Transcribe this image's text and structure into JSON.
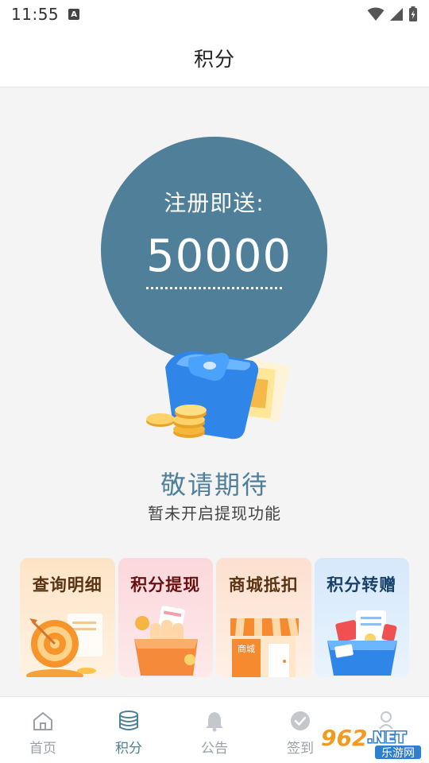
{
  "status_bar": {
    "time": "11:55",
    "indicator": "A",
    "icons": [
      "wifi-icon",
      "signal-icon",
      "battery-icon"
    ]
  },
  "header": {
    "title": "积分"
  },
  "bonus": {
    "label": "注册即送:",
    "value": "50000"
  },
  "notice": {
    "title": "敬请期待",
    "subtitle": "暂未开启提现功能"
  },
  "cards": [
    {
      "label": "查询明细",
      "icon": "target-icon"
    },
    {
      "label": "积分提现",
      "icon": "wallet-icon"
    },
    {
      "label": "商城抵扣",
      "icon": "store-icon",
      "sign": "商城"
    },
    {
      "label": "积分转赠",
      "icon": "gift-box-icon"
    }
  ],
  "nav": [
    {
      "label": "首页",
      "icon": "home-icon",
      "active": false
    },
    {
      "label": "积分",
      "icon": "coins-icon",
      "active": true
    },
    {
      "label": "公告",
      "icon": "bell-icon",
      "active": false
    },
    {
      "label": "签到",
      "icon": "check-circle-icon",
      "active": false
    },
    {
      "label": "",
      "icon": "user-icon",
      "active": false
    }
  ],
  "watermark": {
    "number": "962",
    "suffix": ".NET",
    "caption": "乐游网"
  },
  "colors": {
    "accent": "#4f7f99",
    "nav_inactive": "#9aa0a6",
    "background": "#f4f4f5"
  }
}
